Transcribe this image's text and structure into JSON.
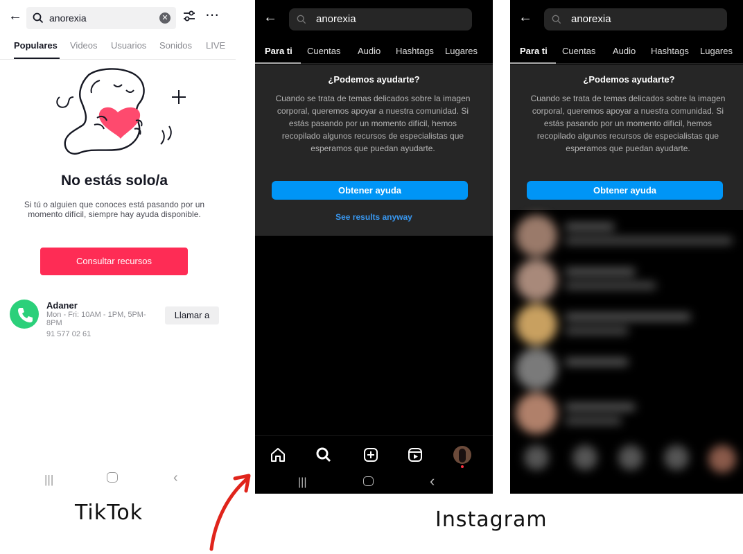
{
  "tiktok": {
    "search_value": "anorexia",
    "tabs": [
      "Populares",
      "Videos",
      "Usuarios",
      "Sonidos",
      "LIVE"
    ],
    "active_tab": "Populares",
    "title": "No estás solo/a",
    "description": "Si tú o alguien que conoces está pasando por un momento difícil, siempre hay ayuda disponible.",
    "button_label": "Consultar recursos",
    "contact": {
      "name": "Adaner",
      "hours": "Mon - Fri: 10AM - 1PM, 5PM-8PM",
      "phone": "91 577 02 61",
      "call_label": "Llamar a"
    },
    "accent_color": "#fe2c55"
  },
  "instagram_1": {
    "search_value": "anorexia",
    "tabs": [
      "Para ti",
      "Cuentas",
      "Audio",
      "Hashtags",
      "Lugares"
    ],
    "active_tab": "Para ti",
    "panel_title": "¿Podemos ayudarte?",
    "panel_text": "Cuando se trata de temas delicados sobre la imagen corporal, queremos apoyar a nuestra comunidad. Si estás pasando por un momento difícil, hemos recopilado algunos recursos de especialistas que esperamos que puedan ayudarte.",
    "button_label": "Obtener ayuda",
    "link_label": "See results anyway",
    "accent_color": "#0095f6"
  },
  "instagram_2": {
    "search_value": "anorexia",
    "tabs": [
      "Para ti",
      "Cuentas",
      "Audio",
      "Hashtags",
      "Lugares"
    ],
    "active_tab": "Para ti",
    "panel_title": "¿Podemos ayudarte?",
    "panel_text": "Cuando se trata de temas delicados sobre la imagen corporal, queremos apoyar a nuestra comunidad. Si estás pasando por un momento difícil, hemos recopilado algunos recursos de especialistas que esperamos que puedan ayudarte.",
    "button_label": "Obtener ayuda"
  },
  "captions": {
    "tiktok": "TikTok",
    "instagram": "Instagram"
  },
  "annotation_color": "#e0241b"
}
